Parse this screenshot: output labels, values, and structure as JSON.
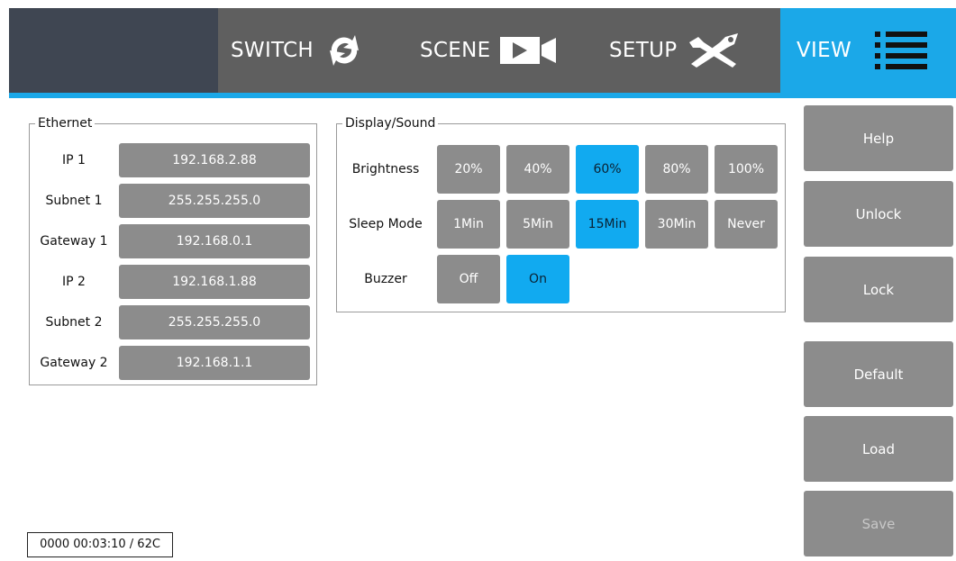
{
  "nav": {
    "tabs": [
      {
        "label": "SWITCH",
        "icon": "switch-arrows-icon"
      },
      {
        "label": "SCENE",
        "icon": "video-camera-icon"
      },
      {
        "label": "SETUP",
        "icon": "tools-icon"
      },
      {
        "label": "VIEW",
        "icon": "menu-list-icon"
      }
    ],
    "active_tab": "VIEW",
    "accent_color": "#1ba8e8",
    "bar_color": "#5f5f5f"
  },
  "ethernet": {
    "title": "Ethernet",
    "rows": [
      {
        "label": "IP 1",
        "value": "192.168.2.88"
      },
      {
        "label": "Subnet 1",
        "value": "255.255.255.0"
      },
      {
        "label": "Gateway 1",
        "value": "192.168.0.1"
      },
      {
        "label": "IP 2",
        "value": "192.168.1.88"
      },
      {
        "label": "Subnet 2",
        "value": "255.255.255.0"
      },
      {
        "label": "Gateway 2",
        "value": "192.168.1.1"
      }
    ]
  },
  "display_sound": {
    "title": "Display/Sound",
    "brightness": {
      "label": "Brightness",
      "options": [
        "20%",
        "40%",
        "60%",
        "80%",
        "100%"
      ],
      "selected": "60%"
    },
    "sleep_mode": {
      "label": "Sleep Mode",
      "options": [
        "1Min",
        "5Min",
        "15Min",
        "30Min",
        "Never"
      ],
      "selected": "15Min"
    },
    "buzzer": {
      "label": "Buzzer",
      "options": [
        "Off",
        "On"
      ],
      "selected": "On"
    }
  },
  "actions": {
    "help": "Help",
    "unlock": "Unlock",
    "lock": "Lock",
    "default": "Default",
    "load": "Load",
    "save": "Save"
  },
  "status": {
    "text": "0000 00:03:10 / 62C"
  }
}
